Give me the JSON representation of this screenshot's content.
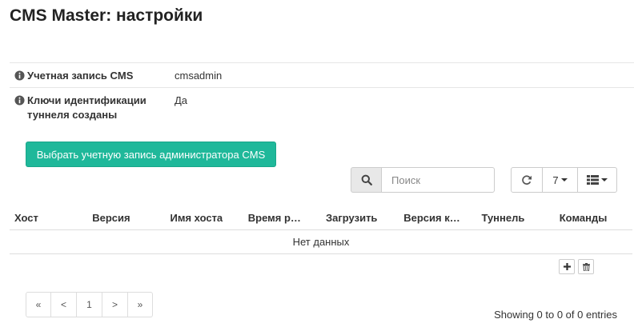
{
  "page": {
    "title": "CMS Master: настройки"
  },
  "info": {
    "rows": [
      {
        "label": "Учетная запись CMS",
        "value": "cmsadmin"
      },
      {
        "label": "Ключи идентификации туннеля созданы",
        "value": "Да"
      }
    ]
  },
  "actions": {
    "select_admin_label": "Выбрать учетную запись администратора CMS"
  },
  "toolbar": {
    "search_placeholder": "Поиск",
    "page_size": "7"
  },
  "table": {
    "columns": [
      "Хост",
      "Версия",
      "Имя хоста",
      "Время р…",
      "Загрузить",
      "Версия к…",
      "Туннель",
      "Команды"
    ],
    "empty_text": "Нет данных"
  },
  "pagination": {
    "first": "«",
    "prev": "<",
    "current": "1",
    "next": ">",
    "last": "»"
  },
  "footer": {
    "entries_text": "Showing 0 to 0 of 0 entries"
  },
  "colors": {
    "accent": "#1fb89a"
  }
}
